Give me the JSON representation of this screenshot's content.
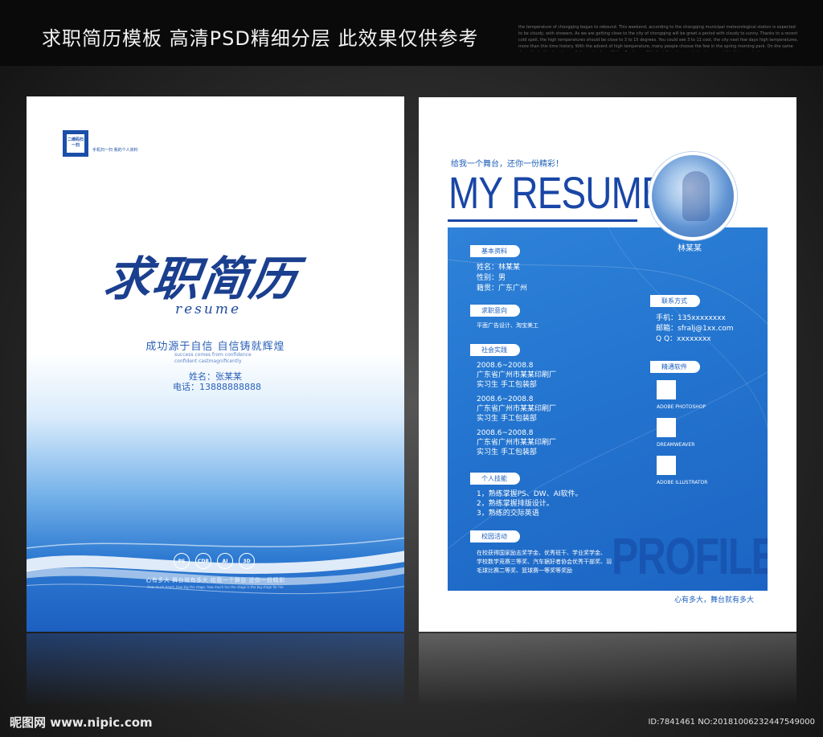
{
  "banner": {
    "title": "求职简历模板 高清PSD精细分层 此效果仅供参考",
    "small_text": "the temperature of chongqing began to rebound. This weekend, according to the chongqing municipal meteorological station is expected to be cloudy, with showers. As we are getting close to the city of chongqing will be greet a period with cloudy to sunny. Thanks to a recent cold spell, the high temperatures should be close to 3 to 15 degrees. You could see 3 to 11 cool, the city next few days high temperatures, more than this time history. With the advent of high temperature, many people choose the few in the spring morning park. On the same day, situated in downtown of chongqing beautiful redbud overall highest forget-me-not street warm sight, it is reported"
  },
  "cover": {
    "qr_label": "二维码扫一扫",
    "qr_caption": "手机扫一扫 我的个人资料",
    "title": "求职简历",
    "title_en": "resume",
    "slogan": "成功源于自信 自信铸就辉煌",
    "slogan_en_1": "success comes from confidence",
    "slogan_en_2": "confident castmagnificently",
    "name": "姓名：张某某",
    "phone": "电话：13888888888",
    "software_icons": [
      "PS",
      "CDR",
      "AI",
      "3D"
    ],
    "bottom_slogan": "心有多大 舞台就有多大 给我一个舞台 还你一段精彩",
    "bottom_slogan_en": "How much heart, how big the stage.   how much fun the stage is the big stage for me"
  },
  "resume": {
    "tagline": "给我一个舞台，还你一份精彩！",
    "title": "MY RESUME",
    "name": "林某某",
    "watermark": "PROFILE",
    "sections": {
      "basic": {
        "heading": "基本资料",
        "lines": [
          "姓名：林某某",
          "性别：男",
          "籍贯：广东广州"
        ]
      },
      "intent": {
        "heading": "求职意向",
        "lines": [
          "平面广告设计、淘宝美工"
        ]
      },
      "experience": {
        "heading": "社会实践",
        "entries": [
          {
            "date": "2008.6~2008.8",
            "company": "广东省广州市某某印刷厂",
            "role": "实习生    手工包装部"
          },
          {
            "date": "2008.6~2008.8",
            "company": "广东省广州市某某印刷厂",
            "role": "实习生    手工包装部"
          },
          {
            "date": "2008.6~2008.8",
            "company": "广东省广州市某某印刷厂",
            "role": "实习生    手工包装部"
          }
        ]
      },
      "skills": {
        "heading": "个人技能",
        "lines": [
          "1，熟练掌握PS、DW、AI软件。",
          "2，熟练掌握排版设计。",
          "3，熟练的交际英语"
        ]
      },
      "campus": {
        "heading": "校园活动",
        "lines": [
          "在校获得国家励志奖学金、优秀班干、学业奖学金、",
          "学校数学竞赛三等奖、汽车据好者协会优秀干部奖、羽",
          "毛球比赛二等奖、篮球赛一等奖等奖励"
        ]
      },
      "contact": {
        "heading": "联系方式",
        "lines": [
          "手机：135xxxxxxxx",
          "邮箱：sfralj@1xx.com",
          "Q Q：xxxxxxxx"
        ]
      },
      "software": {
        "heading": "精通软件",
        "items": [
          "ADOBE PHOTOSHOP",
          "DREAMWEAVER",
          "ADOBE ILLUSTRATOR"
        ]
      }
    },
    "bottom_slogan": "心有多大，舞台就有多大"
  },
  "footer": {
    "logo": "昵图网 www.nipic.com",
    "id": "ID:7841461 NO:20181006232447549000"
  }
}
